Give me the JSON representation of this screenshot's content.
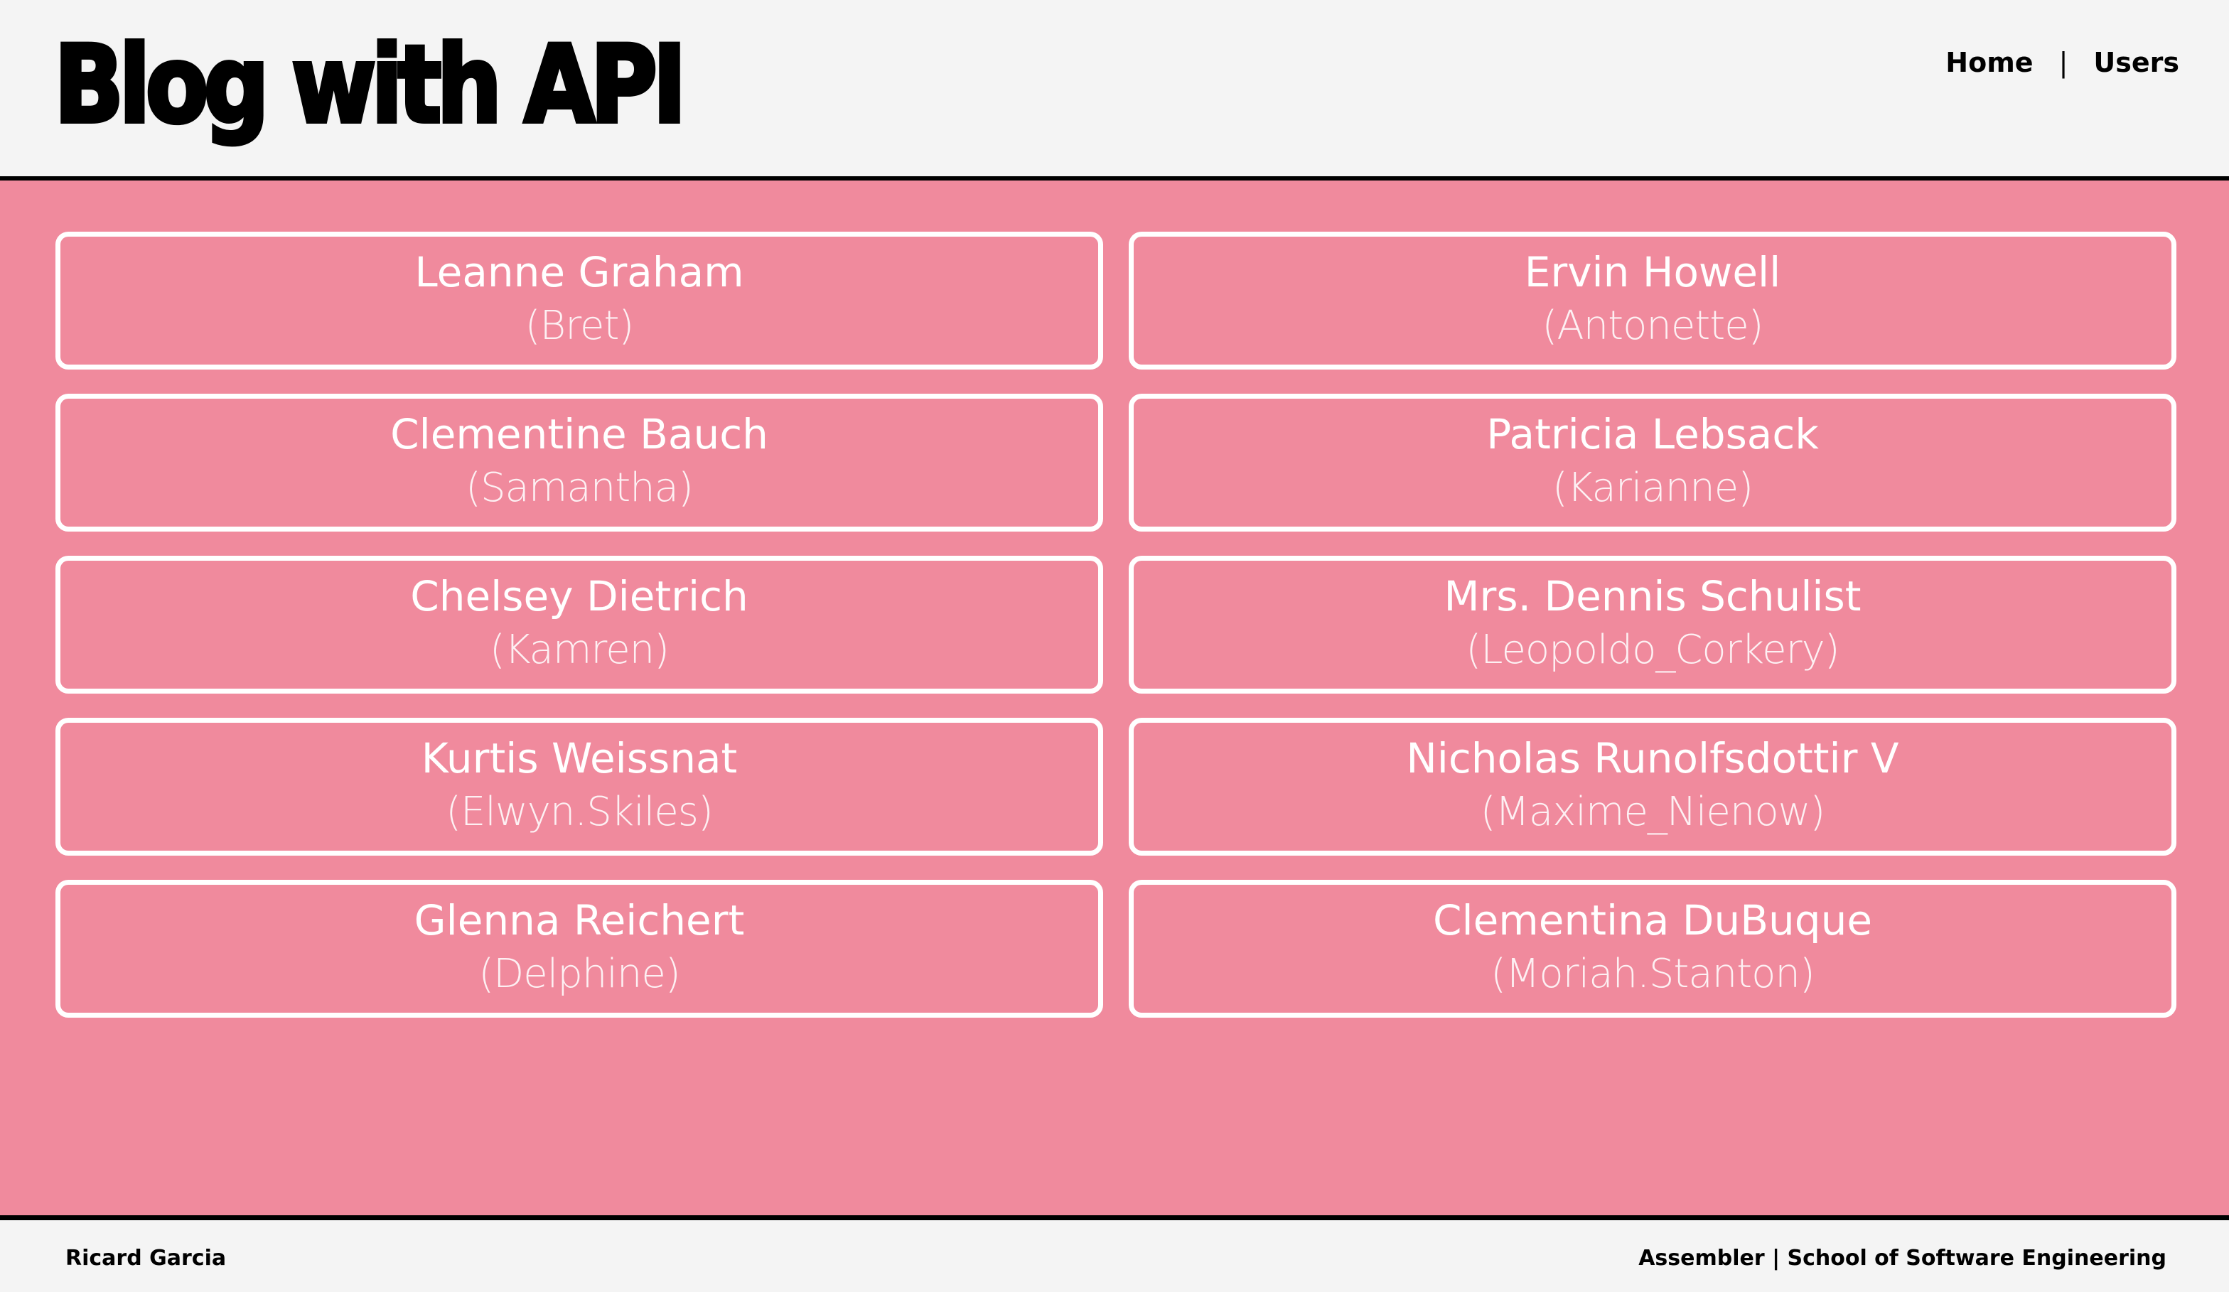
{
  "header": {
    "title": "Blog with API",
    "nav": {
      "home": "Home",
      "separator": "|",
      "users": "Users"
    }
  },
  "users": [
    {
      "name": "Leanne Graham",
      "username": "(Bret)"
    },
    {
      "name": "Ervin Howell",
      "username": "(Antonette)"
    },
    {
      "name": "Clementine Bauch",
      "username": "(Samantha)"
    },
    {
      "name": "Patricia Lebsack",
      "username": "(Karianne)"
    },
    {
      "name": "Chelsey Dietrich",
      "username": "(Kamren)"
    },
    {
      "name": "Mrs. Dennis Schulist",
      "username": "(Leopoldo_Corkery)"
    },
    {
      "name": "Kurtis Weissnat",
      "username": "(Elwyn.Skiles)"
    },
    {
      "name": "Nicholas Runolfsdottir V",
      "username": "(Maxime_Nienow)"
    },
    {
      "name": "Glenna Reichert",
      "username": "(Delphine)"
    },
    {
      "name": "Clementina DuBuque",
      "username": "(Moriah.Stanton)"
    }
  ],
  "footer": {
    "author": "Ricard Garcia",
    "school": "Assembler | School of Software Engineering"
  },
  "colors": {
    "background": "#f08a9d",
    "card_border": "#ffffff",
    "header_bg": "#f4f4f4"
  }
}
